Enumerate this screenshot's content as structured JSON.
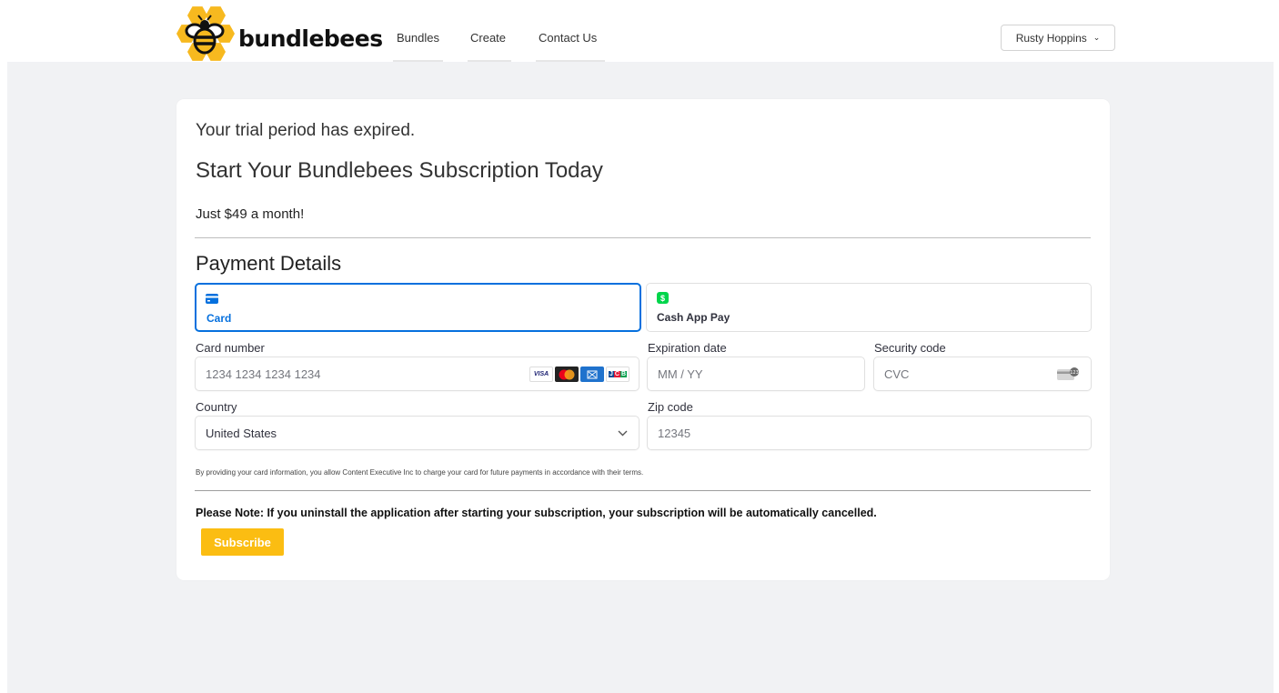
{
  "brand": {
    "name": "bundlebees"
  },
  "nav": {
    "items": [
      "Bundles",
      "Create",
      "Contact Us"
    ]
  },
  "user": {
    "name": "Rusty Hoppins"
  },
  "content": {
    "trial_message": "Your trial period has expired.",
    "headline": "Start Your Bundlebees Subscription Today",
    "price": "Just $49 a month!",
    "payment_title": "Payment Details"
  },
  "payment": {
    "tabs": [
      {
        "label": "Card",
        "icon": "card-icon",
        "selected": true
      },
      {
        "label": "Cash App Pay",
        "icon": "cash-app-icon",
        "selected": false
      }
    ],
    "fields": {
      "card_number": {
        "label": "Card number",
        "placeholder": "1234 1234 1234 1234"
      },
      "expiration": {
        "label": "Expiration date",
        "placeholder": "MM / YY"
      },
      "security": {
        "label": "Security code",
        "placeholder": "CVC"
      },
      "country": {
        "label": "Country",
        "value": "United States"
      },
      "zip": {
        "label": "Zip code",
        "placeholder": "12345"
      }
    },
    "card_brands": [
      "VISA",
      "MC",
      "AMEX",
      "JCB"
    ],
    "terms": "By providing your card information, you allow Content Executive Inc to charge your card for future payments in accordance with their terms."
  },
  "note": "Please Note: If you uninstall the application after starting your subscription, your subscription will be automatically cancelled.",
  "subscribe_label": "Subscribe",
  "colors": {
    "accent": "#fbbd12",
    "stripe_blue": "#0570de",
    "cash_app_green": "#00d54b",
    "background": "#f1f2f4"
  }
}
